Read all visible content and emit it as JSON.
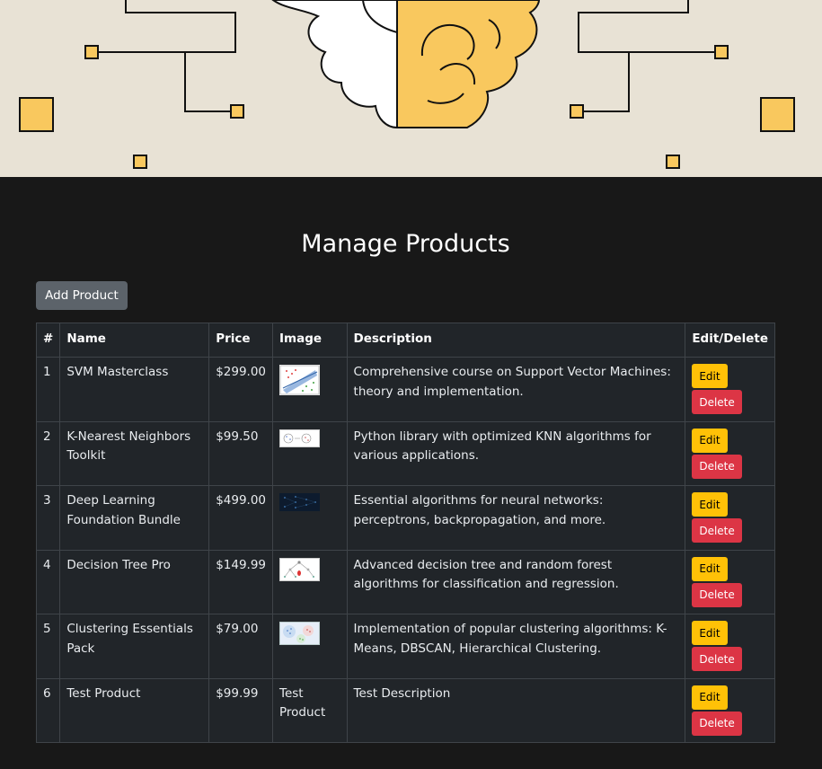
{
  "page": {
    "title": "Manage Products"
  },
  "toolbar": {
    "add_label": "Add Product"
  },
  "table": {
    "headers": {
      "num": "#",
      "name": "Name",
      "price": "Price",
      "image": "Image",
      "description": "Description",
      "actions": "Edit/Delete"
    },
    "edit_label": "Edit",
    "delete_label": "Delete",
    "rows": [
      {
        "num": "1",
        "name": "SVM Masterclass",
        "price": "$299.00",
        "image": "svm-plot",
        "image_text": "",
        "description": "Comprehensive course on Support Vector Machines: theory and implementation."
      },
      {
        "num": "2",
        "name": "K-Nearest Neighbors Toolkit",
        "price": "$99.50",
        "image": "knn-diagram",
        "image_text": "",
        "description": "Python library with optimized KNN algorithms for various applications."
      },
      {
        "num": "3",
        "name": "Deep Learning Foundation Bundle",
        "price": "$499.00",
        "image": "neural-net-dark",
        "image_text": "",
        "description": "Essential algorithms for neural networks: perceptrons, backpropagation, and more."
      },
      {
        "num": "4",
        "name": "Decision Tree Pro",
        "price": "$149.99",
        "image": "decision-tree",
        "image_text": "",
        "description": "Advanced decision tree and random forest algorithms for classification and regression."
      },
      {
        "num": "5",
        "name": "Clustering Essentials Pack",
        "price": "$79.00",
        "image": "clusters",
        "image_text": "",
        "description": "Implementation of popular clustering algorithms: K-Means, DBSCAN, Hierarchical Clustering."
      },
      {
        "num": "6",
        "name": "Test Product",
        "price": "$99.99",
        "image": "",
        "image_text": "Test Product",
        "description": "Test Description"
      }
    ]
  },
  "colors": {
    "banner_bg": "#e8e2d5",
    "brain_yellow": "#f9c85e",
    "edit": "#ffc107",
    "delete": "#dc3545",
    "add": "#5c636a"
  }
}
